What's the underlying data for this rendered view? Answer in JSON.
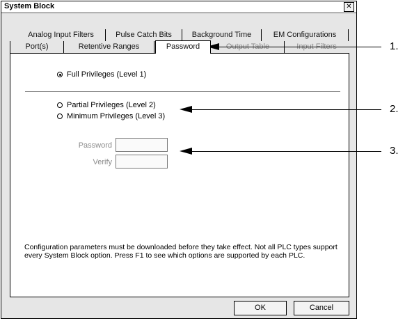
{
  "window": {
    "title": "System Block",
    "close_label": "✕"
  },
  "tabs_back": [
    "Analog Input Filters",
    "Pulse Catch Bits",
    "Background Time",
    "EM Configurations"
  ],
  "tabs_front": [
    "Port(s)",
    "Retentive Ranges",
    "Password",
    "Output Table",
    "Input Filters"
  ],
  "active_tab": "Password",
  "privileges": {
    "full": "Full Privileges (Level 1)",
    "partial": "Partial Privileges (Level 2)",
    "minimum": "Minimum Privileges (Level 3)",
    "selected": "full"
  },
  "fields": {
    "password_label": "Password",
    "password_value": "",
    "verify_label": "Verify",
    "verify_value": ""
  },
  "notice": "Configuration parameters must be downloaded before they take effect. Not all PLC types support every System Block option.  Press F1 to see which options are supported by each PLC.",
  "buttons": {
    "ok": "OK",
    "cancel": "Cancel"
  },
  "callouts": [
    "1.",
    "2.",
    "3."
  ]
}
